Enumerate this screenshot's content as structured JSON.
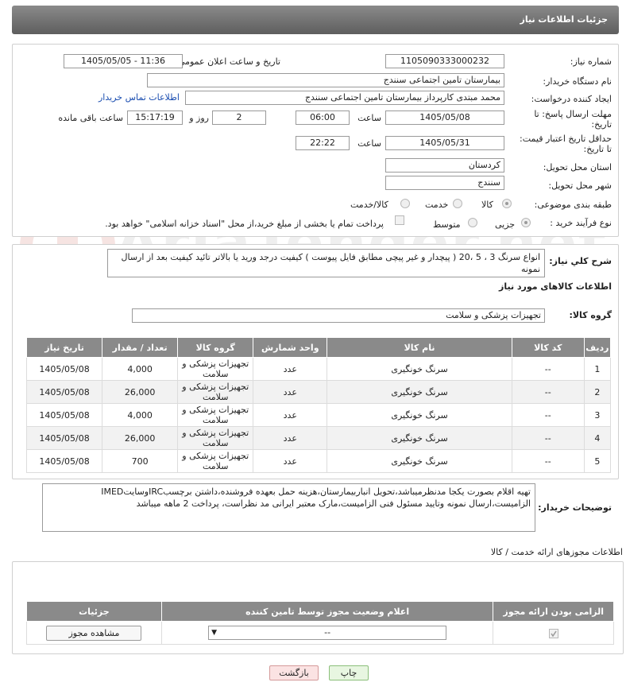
{
  "header": {
    "title": "جزئیات اطلاعات نیاز"
  },
  "form": {
    "need_number_label": "شماره نیاز:",
    "need_number": "1105090333000232",
    "announce_label": "تاریخ و ساعت اعلان عمومی:",
    "announce_value": "1405/05/05 - 11:36",
    "buyer_label": "نام دستگاه خریدار:",
    "buyer_value": "بیمارستان تامین اجتماعی سنندج",
    "creator_label": "ایجاد کننده درخواست:",
    "creator_value": "محمد مبتدی کارپرداز بیمارستان تامین اجتماعی سنندج",
    "contact_link": "اطلاعات تماس خریدار",
    "reply_deadline_label": "مهلت ارسال پاسخ: تا تاریخ:",
    "reply_date": "1405/05/08",
    "time_label": "ساعت",
    "reply_time": "06:00",
    "days_value": "2",
    "days_label": "روز و",
    "remaining_time": "15:17:19",
    "remaining_label": "ساعت باقی مانده",
    "validity_label": "حداقل تاریخ اعتبار قیمت: تا تاریخ:",
    "validity_date": "1405/05/31",
    "validity_time": "22:22",
    "province_label": "استان محل تحویل:",
    "province_value": "کردستان",
    "city_label": "شهر محل تحویل:",
    "city_value": "سنندج",
    "category_label": "طبقه بندی موضوعی:",
    "category_options": [
      "کالا",
      "خدمت",
      "کالا/خدمت"
    ],
    "process_label": "نوع فرآیند خرید :",
    "process_options": [
      "جزیی",
      "متوسط"
    ],
    "payment_note": "پرداخت تمام یا بخشی از مبلغ خرید،از محل \"اسناد خزانه اسلامی\" خواهد بود."
  },
  "summary": {
    "label": "شرح کلي نياز:",
    "text": "انواع سرنگ 3 ، 5 ،20 (  پیچدار و غیر پیچی مطابق فایل پیوست ) کیفیت درجد ورید یا بالاتر تائید کیفیت بعد از ارسال نمونه"
  },
  "goods": {
    "section_title": "اطلاعات کالاهای مورد نیاز",
    "group_label": "گروه کالا:",
    "group_value": "تجهیزات پزشکی و سلامت",
    "columns": [
      "ردیف",
      "کد کالا",
      "نام کالا",
      "واحد شمارش",
      "گروه کالا",
      "تعداد / مقدار",
      "تاریخ نیاز"
    ],
    "rows": [
      [
        "1",
        "--",
        "سرنگ خونگیری",
        "عدد",
        "تجهیزات پزشکی و سلامت",
        "4,000",
        "1405/05/08"
      ],
      [
        "2",
        "--",
        "سرنگ خونگیری",
        "عدد",
        "تجهیزات پزشکی و سلامت",
        "26,000",
        "1405/05/08"
      ],
      [
        "3",
        "--",
        "سرنگ خونگیری",
        "عدد",
        "تجهیزات پزشکی و سلامت",
        "4,000",
        "1405/05/08"
      ],
      [
        "4",
        "--",
        "سرنگ خونگیری",
        "عدد",
        "تجهیزات پزشکی و سلامت",
        "26,000",
        "1405/05/08"
      ],
      [
        "5",
        "--",
        "سرنگ خونگیری",
        "عدد",
        "تجهیزات پزشکی و سلامت",
        "700",
        "1405/05/08"
      ]
    ]
  },
  "buyer_notes": {
    "label": "توضیحات خریدار:",
    "text": "تهیه اقلام بصورت یکجا مدنظرمیباشد،تحویل انباربیمارستان،هزینه حمل بعهده فروشنده،داشتن برچسبIRCوسایتIMED الزامیست،ارسال نمونه وتایید مسئول فنی الزامیست،مارک معتبر ایرانی مد نظراست، پرداخت 2 ماهه میباشد"
  },
  "permits": {
    "title": "اطلاعات مجوزهای ارائه خدمت / کالا",
    "columns": [
      "الزامی بودن ارائه مجوز",
      "اعلام وضعیت مجوز توسط تامین کننده",
      "جزئیات"
    ],
    "select_value": "--",
    "view_button": "مشاهده مجوز"
  },
  "actions": {
    "print": "چاپ",
    "back": "بازگشت"
  },
  "watermark": {
    "text": "AriaTender.net"
  },
  "colors": {
    "header": "#6f6f6f",
    "table_header": "#8a8a8a",
    "link": "#1a4db0",
    "back_button": "#fbe3e3",
    "print_button": "#e8f6e1"
  }
}
